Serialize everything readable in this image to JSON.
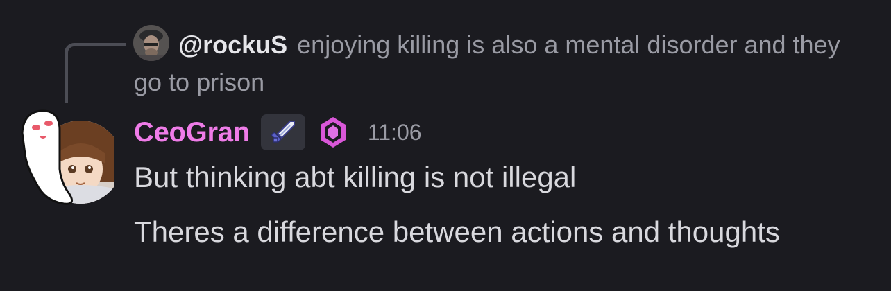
{
  "reply": {
    "author": "@rockuS",
    "text": "enjoying killing is also a mental disorder and they go to prison",
    "avatar_icon": "avatar-photo-icon"
  },
  "message": {
    "username": "CeoGran",
    "badges": [
      "sword-icon",
      "gem-icon"
    ],
    "timestamp": "11:06",
    "avatar_icon": "anime-ghost-avatar-icon",
    "lines": [
      "But thinking abt killing is not illegal",
      "Theres a difference between actions and thoughts"
    ]
  },
  "colors": {
    "background": "#1b1b20",
    "username": "#ef7ce8",
    "text": "#d9d9de",
    "muted": "#9a9ba4",
    "badge_bg": "#33343c"
  }
}
